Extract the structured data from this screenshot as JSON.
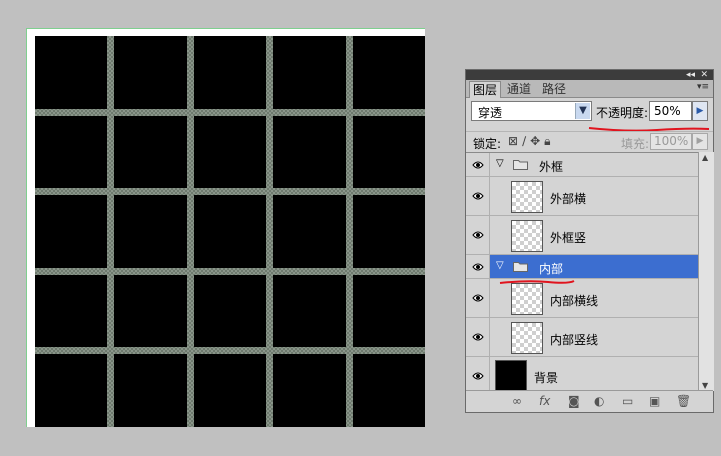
{
  "canvas": {
    "grid_rows": 5,
    "grid_cols": 5,
    "cell_color": "#000000",
    "line_color": "#7a877a"
  },
  "panel": {
    "tabs": [
      {
        "label": "图层",
        "active": true
      },
      {
        "label": "通道",
        "active": false
      },
      {
        "label": "路径",
        "active": false
      }
    ],
    "titlebar_collapse": "◂◂",
    "titlebar_close": "✕",
    "menu_icon": "▾≡",
    "blend_mode": "穿透",
    "opacity_label": "不透明度:",
    "opacity_value": "50%",
    "lock_label": "锁定:",
    "fill_label": "填充:",
    "fill_value": "100%",
    "annotation_color": "#e0141e",
    "selected_color": "#3c6ed0"
  },
  "layers": [
    {
      "type": "group",
      "name": "外框",
      "expanded": true,
      "selected": false
    },
    {
      "type": "layer",
      "name": "外部横",
      "thumb": "transparent"
    },
    {
      "type": "layer",
      "name": "外框竖",
      "thumb": "transparent"
    },
    {
      "type": "group",
      "name": "内部",
      "expanded": true,
      "selected": true
    },
    {
      "type": "layer",
      "name": "内部横线",
      "thumb": "transparent"
    },
    {
      "type": "layer",
      "name": "内部竖线",
      "thumb": "transparent"
    },
    {
      "type": "background",
      "name": "背景",
      "thumb": "black"
    }
  ],
  "footer_icons": [
    "link-icon",
    "fx-icon",
    "mask-icon",
    "adjustment-icon",
    "group-icon",
    "new-layer-icon",
    "trash-icon"
  ]
}
